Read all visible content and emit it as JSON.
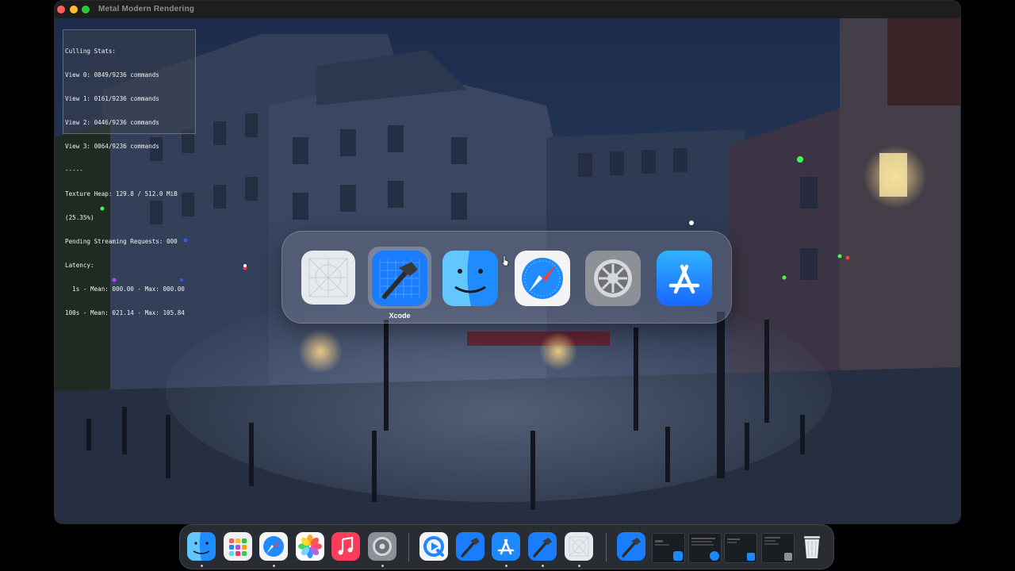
{
  "window": {
    "title": "Metal Modern Rendering"
  },
  "stats": {
    "lines": [
      "Culling Stats:",
      "View 0: 0849/9236 commands",
      "View 1: 0161/9236 commands",
      "View 2: 0446/9236 commands",
      "View 3: 0064/9236 commands",
      "-----",
      "Texture Heap: 129.8 / 512.0 MiB",
      "(25.35%)",
      "Pending Streaming Requests: 000",
      "Latency:",
      "  1s - Mean: 000.00 - Max: 000.00",
      "100s - Mean: 021.14 - Max: 105.84"
    ]
  },
  "app_switcher": {
    "apps": [
      {
        "name": "Blank App",
        "icon": "blank-app-icon"
      },
      {
        "name": "Xcode",
        "icon": "xcode-icon",
        "selected": true
      },
      {
        "name": "Finder",
        "icon": "finder-icon"
      },
      {
        "name": "Safari",
        "icon": "safari-icon"
      },
      {
        "name": "System Settings",
        "icon": "settings-icon"
      },
      {
        "name": "App Store",
        "icon": "app-store-icon"
      }
    ],
    "selected_label": "Xcode"
  },
  "dock": {
    "items": [
      {
        "icon": "finder-icon",
        "running": true
      },
      {
        "icon": "launchpad-icon",
        "running": false
      },
      {
        "icon": "safari-icon",
        "running": true
      },
      {
        "icon": "photos-icon",
        "running": false
      },
      {
        "icon": "music-icon",
        "running": false
      },
      {
        "icon": "settings-icon",
        "running": true
      },
      {
        "icon": "quicktime-icon",
        "running": false
      },
      {
        "icon": "xcode-icon",
        "running": false
      },
      {
        "icon": "app-store-icon",
        "running": true
      },
      {
        "icon": "xcode-icon",
        "running": true
      },
      {
        "icon": "blank-app-icon",
        "running": true
      },
      {
        "icon": "xcode-icon",
        "running": false
      },
      {
        "icon": "window-thumbnail-icon",
        "running": false
      },
      {
        "icon": "window-thumbnail-icon",
        "running": false
      },
      {
        "icon": "window-thumbnail-icon",
        "running": false
      },
      {
        "icon": "window-thumbnail-icon",
        "running": false
      },
      {
        "icon": "trash-icon",
        "running": false
      }
    ]
  },
  "colors": {
    "close": "#ff5f57",
    "minimize": "#febc2e",
    "zoom": "#28c840",
    "accent": "#1e88ff"
  }
}
